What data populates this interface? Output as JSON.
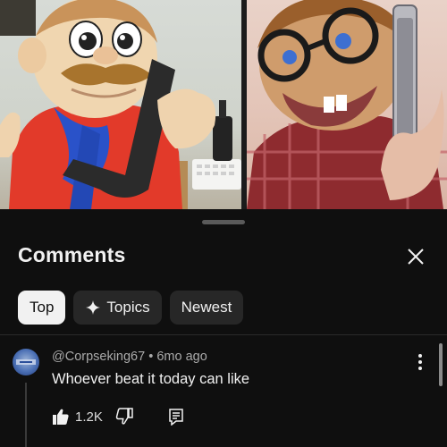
{
  "video": {
    "left_scene": "puppet-holding-phone-handset",
    "right_scene": "puppet-with-glasses-holding-phone"
  },
  "sheet": {
    "title": "Comments",
    "close_icon": "close-icon",
    "filters": [
      {
        "label": "Top",
        "active": true
      },
      {
        "label": "Topics",
        "active": false,
        "icon": "sparkle-icon"
      },
      {
        "label": "Newest",
        "active": false
      }
    ]
  },
  "comments": [
    {
      "author": "@Corpseking67",
      "age": "6mo ago",
      "text": "Whoever beat it today can like",
      "likes": "1.2K",
      "avatar_icon": "avatar"
    }
  ],
  "colors": {
    "background": "#0f0f0f",
    "chip_active_bg": "#f1f1f1",
    "chip_bg": "#272727",
    "muted_text": "#aaaaaa"
  }
}
